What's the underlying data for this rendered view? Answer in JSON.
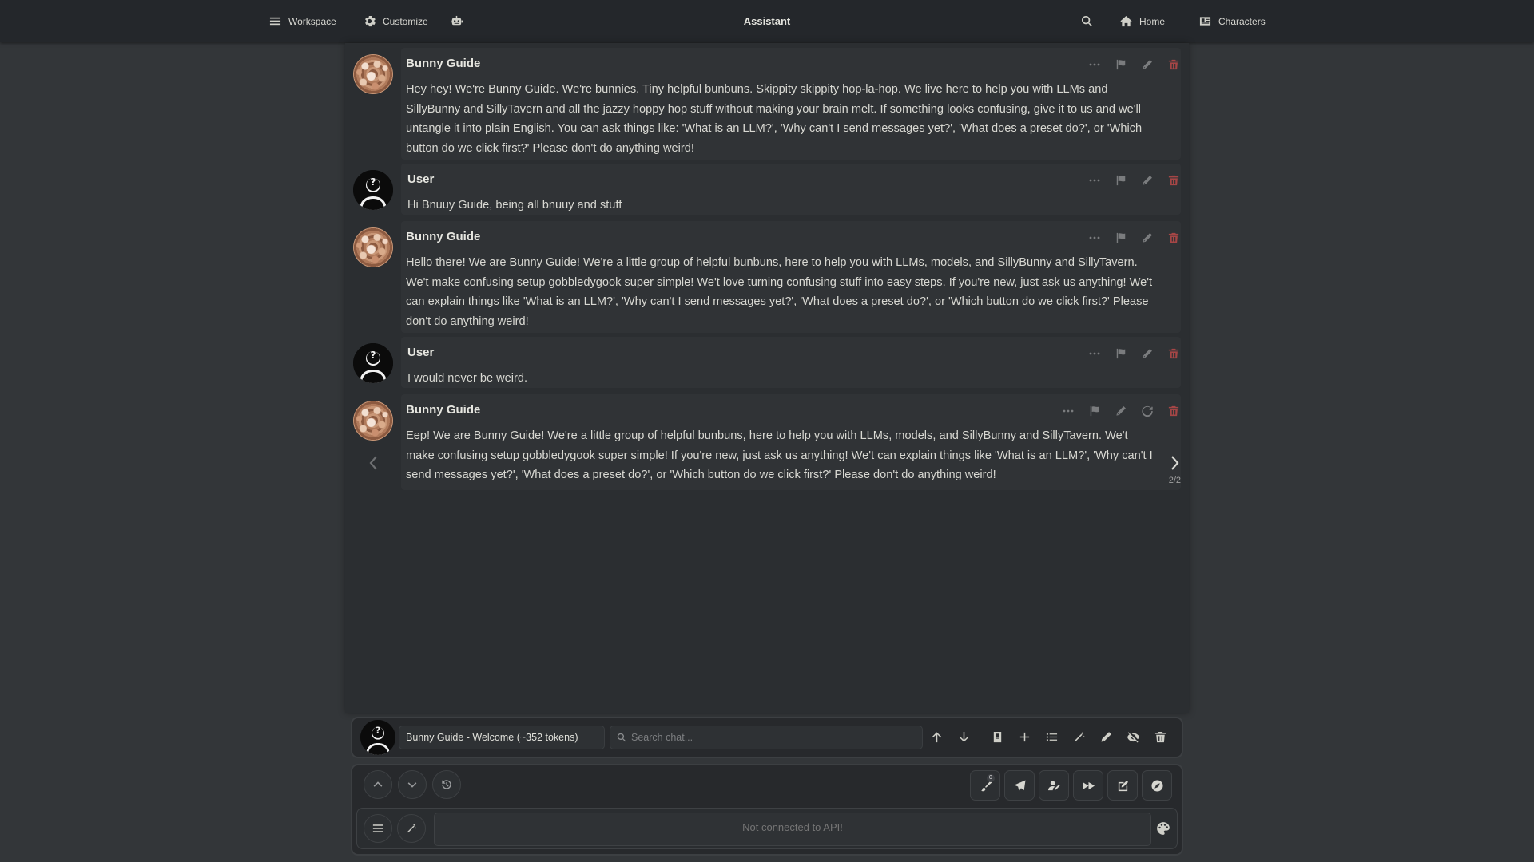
{
  "topbar": {
    "workspace": "Workspace",
    "customize": "Customize",
    "title": "Assistant",
    "home": "Home",
    "characters": "Characters"
  },
  "messages": [
    {
      "name": "Bunny Guide",
      "avatar": "bunny-avatar",
      "text": "Hey hey! We're Bunny Guide. We're bunnies. Tiny helpful bunbuns. Skippity skippity hop-la-hop. We live here to help you with LLMs and SillyBunny and SillyTavern and all the jazzy hoppy hop stuff without making your brain melt. If something looks confusing, give it to us and we'll untangle it into plain English. You can ask things like: 'What is an LLM?', 'Why can't I send messages yet?', 'What does a preset do?', or 'Which button do we click first?' Please don't do anything weird!"
    },
    {
      "name": "User",
      "avatar": "user-avatar",
      "text": "Hi Bnuuy Guide, being all bnuuy and stuff"
    },
    {
      "name": "Bunny Guide",
      "avatar": "bunny-avatar",
      "text": "Hello there! We are Bunny Guide! We're a little group of helpful bunbuns, here to help you with LLMs, models, and SillyBunny and SillyTavern. We't make confusing setup gobbledygook super simple! We't love turning confusing stuff into easy steps. If you're new, just ask us anything! We't can explain things like 'What is an LLM?', 'Why can't I send messages yet?', 'What does a preset do?', or 'Which button do we click first?' Please don't do anything weird!"
    },
    {
      "name": "User",
      "avatar": "user-avatar",
      "text": "I would never be weird."
    },
    {
      "name": "Bunny Guide",
      "avatar": "bunny-avatar",
      "text": "Eep! We are Bunny Guide! We're a little group of helpful bunbuns, here to help you with LLMs, models, and SillyBunny and SillyTavern. We't make confusing setup gobbledygook super simple! If you're new, just ask us anything! We't can explain things like 'What is an LLM?', 'Why can't I send messages yet?', 'What does a preset do?', or 'Which button do we click first?' Please don't do anything weird!",
      "swipe_counter": "2/2"
    }
  ],
  "chat_manager": {
    "selected_chat": "Bunny Guide - Welcome (~352 tokens)",
    "search_placeholder": "Search chat..."
  },
  "composer": {
    "input_placeholder": "Not connected to API!",
    "brush_badge": "0"
  },
  "colors": {
    "background": "#333639",
    "topbar": "#24272b",
    "panel": "#2b2e31",
    "delete": "#a54646"
  }
}
